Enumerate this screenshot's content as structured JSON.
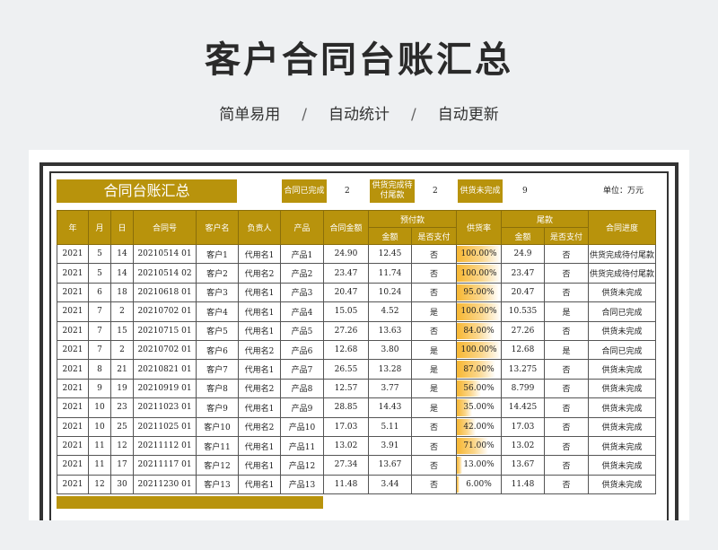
{
  "hero": {
    "title": "客户合同台账汇总",
    "tags": [
      "简单易用",
      "自动统计",
      "自动更新"
    ],
    "separator": "/"
  },
  "sheet": {
    "title": "合同台账汇总",
    "stats": [
      {
        "label": "合同已完成",
        "value": "2"
      },
      {
        "label": "供货完成待付尾款",
        "value": "2"
      },
      {
        "label": "供货未完成",
        "value": "9"
      }
    ],
    "unit": "单位：万元"
  },
  "colors": {
    "accent": "#b8930c",
    "bar": "#f7b733"
  },
  "table": {
    "headers": {
      "year": "年",
      "month": "月",
      "day": "日",
      "contract_no": "合同号",
      "customer": "客户名",
      "owner": "负责人",
      "product": "产品",
      "amount": "合同金额",
      "prepay": "预付款",
      "prepay_amount": "金额",
      "prepay_paid": "是否支付",
      "supply_rate": "供货率",
      "final": "尾款",
      "final_amount": "金额",
      "final_paid": "是否支付",
      "progress": "合同进度"
    },
    "rows": [
      {
        "year": "2021",
        "month": "5",
        "day": "14",
        "no": "20210514 01",
        "customer": "客户1",
        "owner": "代用名1",
        "product": "产品1",
        "amount": "24.90",
        "prepay": "12.45",
        "prepay_paid": "否",
        "rate": "100.00%",
        "rate_value": 1.0,
        "final": "24.9",
        "final_paid": "否",
        "progress": "供货完成待付尾款"
      },
      {
        "year": "2021",
        "month": "5",
        "day": "14",
        "no": "20210514 02",
        "customer": "客户2",
        "owner": "代用名2",
        "product": "产品2",
        "amount": "23.47",
        "prepay": "11.74",
        "prepay_paid": "否",
        "rate": "100.00%",
        "rate_value": 1.0,
        "final": "23.47",
        "final_paid": "否",
        "progress": "供货完成待付尾款"
      },
      {
        "year": "2021",
        "month": "6",
        "day": "18",
        "no": "20210618 01",
        "customer": "客户3",
        "owner": "代用名1",
        "product": "产品3",
        "amount": "20.47",
        "prepay": "10.24",
        "prepay_paid": "否",
        "rate": "95.00%",
        "rate_value": 0.95,
        "final": "20.47",
        "final_paid": "否",
        "progress": "供货未完成"
      },
      {
        "year": "2021",
        "month": "7",
        "day": "2",
        "no": "20210702 01",
        "customer": "客户4",
        "owner": "代用名1",
        "product": "产品4",
        "amount": "15.05",
        "prepay": "4.52",
        "prepay_paid": "是",
        "rate": "100.00%",
        "rate_value": 1.0,
        "final": "10.535",
        "final_paid": "是",
        "progress": "合同已完成"
      },
      {
        "year": "2021",
        "month": "7",
        "day": "15",
        "no": "20210715 01",
        "customer": "客户5",
        "owner": "代用名1",
        "product": "产品5",
        "amount": "27.26",
        "prepay": "13.63",
        "prepay_paid": "否",
        "rate": "84.00%",
        "rate_value": 0.84,
        "final": "27.26",
        "final_paid": "否",
        "progress": "供货未完成"
      },
      {
        "year": "2021",
        "month": "7",
        "day": "2",
        "no": "20210702 01",
        "customer": "客户6",
        "owner": "代用名2",
        "product": "产品6",
        "amount": "12.68",
        "prepay": "3.80",
        "prepay_paid": "是",
        "rate": "100.00%",
        "rate_value": 1.0,
        "final": "12.68",
        "final_paid": "是",
        "progress": "合同已完成"
      },
      {
        "year": "2021",
        "month": "8",
        "day": "21",
        "no": "20210821 01",
        "customer": "客户7",
        "owner": "代用名1",
        "product": "产品7",
        "amount": "26.55",
        "prepay": "13.28",
        "prepay_paid": "是",
        "rate": "87.00%",
        "rate_value": 0.87,
        "final": "13.275",
        "final_paid": "否",
        "progress": "供货未完成"
      },
      {
        "year": "2021",
        "month": "9",
        "day": "19",
        "no": "20210919 01",
        "customer": "客户8",
        "owner": "代用名2",
        "product": "产品8",
        "amount": "12.57",
        "prepay": "3.77",
        "prepay_paid": "是",
        "rate": "56.00%",
        "rate_value": 0.56,
        "final": "8.799",
        "final_paid": "否",
        "progress": "供货未完成"
      },
      {
        "year": "2021",
        "month": "10",
        "day": "23",
        "no": "20211023 01",
        "customer": "客户9",
        "owner": "代用名1",
        "product": "产品9",
        "amount": "28.85",
        "prepay": "14.43",
        "prepay_paid": "是",
        "rate": "35.00%",
        "rate_value": 0.35,
        "final": "14.425",
        "final_paid": "否",
        "progress": "供货未完成"
      },
      {
        "year": "2021",
        "month": "10",
        "day": "25",
        "no": "20211025 01",
        "customer": "客户10",
        "owner": "代用名2",
        "product": "产品10",
        "amount": "17.03",
        "prepay": "5.11",
        "prepay_paid": "否",
        "rate": "42.00%",
        "rate_value": 0.42,
        "final": "17.03",
        "final_paid": "否",
        "progress": "供货未完成"
      },
      {
        "year": "2021",
        "month": "11",
        "day": "12",
        "no": "20211112 01",
        "customer": "客户11",
        "owner": "代用名1",
        "product": "产品11",
        "amount": "13.02",
        "prepay": "3.91",
        "prepay_paid": "否",
        "rate": "71.00%",
        "rate_value": 0.71,
        "final": "13.02",
        "final_paid": "否",
        "progress": "供货未完成"
      },
      {
        "year": "2021",
        "month": "11",
        "day": "17",
        "no": "20211117 01",
        "customer": "客户12",
        "owner": "代用名1",
        "product": "产品12",
        "amount": "27.34",
        "prepay": "13.67",
        "prepay_paid": "否",
        "rate": "13.00%",
        "rate_value": 0.13,
        "final": "13.67",
        "final_paid": "否",
        "progress": "供货未完成"
      },
      {
        "year": "2021",
        "month": "12",
        "day": "30",
        "no": "20211230 01",
        "customer": "客户13",
        "owner": "代用名1",
        "product": "产品13",
        "amount": "11.48",
        "prepay": "3.44",
        "prepay_paid": "否",
        "rate": "6.00%",
        "rate_value": 0.06,
        "final": "11.48",
        "final_paid": "否",
        "progress": "供货未完成"
      }
    ]
  }
}
